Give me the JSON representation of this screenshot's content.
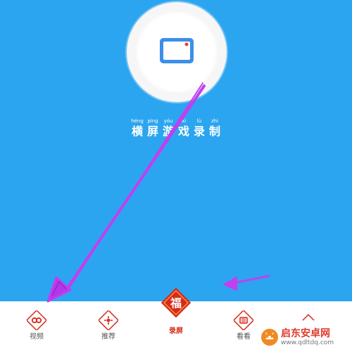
{
  "record": {
    "title_chars": [
      {
        "pinyin": "héng",
        "hanzi": "横"
      },
      {
        "pinyin": "píng",
        "hanzi": "屏"
      },
      {
        "pinyin": "yóu",
        "hanzi": "游"
      },
      {
        "pinyin": "xì",
        "hanzi": "戏"
      },
      {
        "pinyin": "lù",
        "hanzi": "录"
      },
      {
        "pinyin": "zhì",
        "hanzi": "制"
      }
    ]
  },
  "tabbar": {
    "tabs": [
      {
        "label": "视频",
        "icon": "video-icon"
      },
      {
        "label": "推荐",
        "icon": "recommend-icon"
      },
      {
        "label": "录屏",
        "icon": "fu-badge-icon",
        "active": true
      },
      {
        "label": "看看",
        "icon": "watch-icon"
      },
      {
        "label": "",
        "icon": "mine-icon"
      }
    ],
    "center_glyph": "福"
  },
  "watermark": {
    "title": "启东安卓网",
    "url": "www.qdltdq.com"
  },
  "colors": {
    "background": "#2ba5f0",
    "accent_red": "#d82a1c",
    "arrow_purple": "#c040f0",
    "phone_blue": "#3b8fe8"
  }
}
